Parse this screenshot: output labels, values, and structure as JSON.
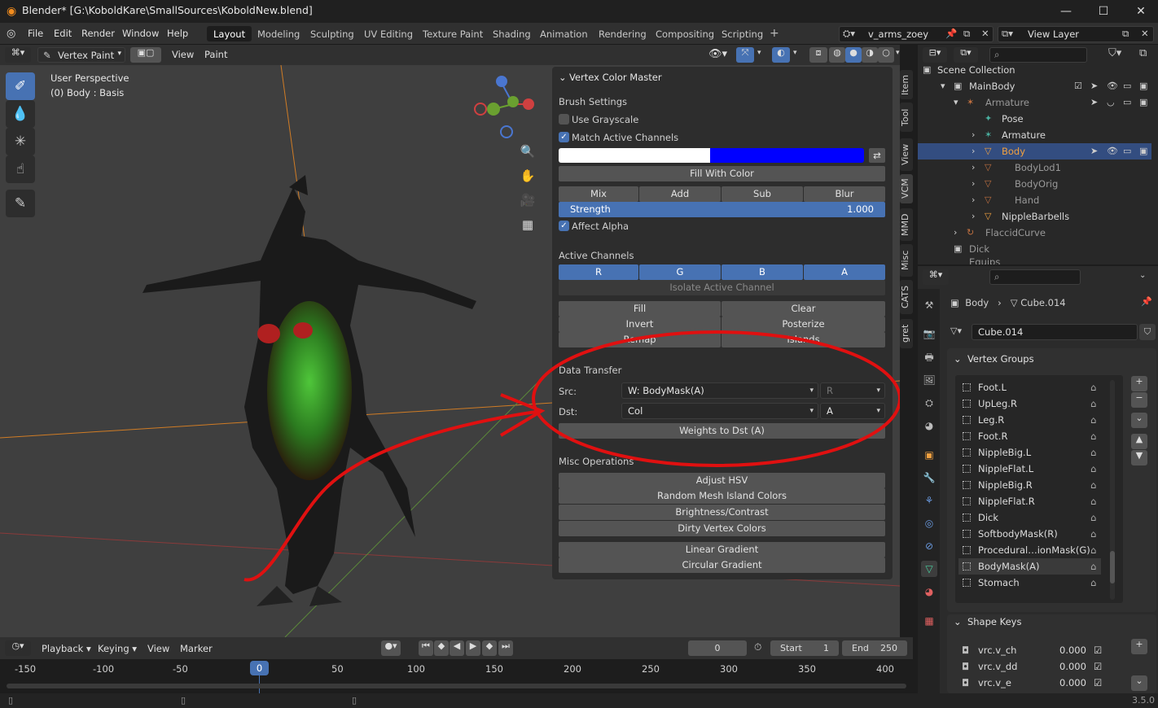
{
  "window": {
    "title": "Blender* [G:\\KoboldKare\\SmallSources\\KoboldNew.blend]"
  },
  "menu": {
    "items": [
      "File",
      "Edit",
      "Render",
      "Window",
      "Help"
    ]
  },
  "workspaces": [
    "Layout",
    "Modeling",
    "Sculpting",
    "UV Editing",
    "Texture Paint",
    "Shading",
    "Animation",
    "Rendering",
    "Compositing",
    "Scripting"
  ],
  "scene": {
    "name": "v_arms_zoey",
    "view_layer": "View Layer"
  },
  "viewport_header": {
    "mode": "Vertex Paint",
    "view": "View",
    "paint": "Paint"
  },
  "viewport": {
    "perspective": "User Perspective",
    "object_info": "(0) Body : Basis"
  },
  "vcm": {
    "title": "Vertex Color Master",
    "brush_settings": "Brush Settings",
    "use_grayscale": "Use Grayscale",
    "match_active_channels": "Match Active Channels",
    "fill_with_color": "Fill With Color",
    "blend_modes": [
      "Mix",
      "Add",
      "Sub",
      "Blur"
    ],
    "strength_label": "Strength",
    "strength_value": "1.000",
    "affect_alpha": "Affect Alpha",
    "active_channels": "Active Channels",
    "channels": [
      "R",
      "G",
      "B",
      "A"
    ],
    "isolate": "Isolate Active Channel",
    "ops": [
      "Fill",
      "Clear",
      "Invert",
      "Posterize",
      "Remap",
      "Islands"
    ],
    "data_transfer": "Data Transfer",
    "src_label": "Src:",
    "src_value": "W: BodyMask(A)",
    "src_channel": "R",
    "dst_label": "Dst:",
    "dst_value": "Col",
    "dst_channel": "A",
    "weights_button": "Weights to Dst (A)",
    "misc_title": "Misc Operations",
    "misc": [
      "Adjust HSV",
      "Random Mesh Island Colors",
      "Brightness/Contrast",
      "Dirty Vertex Colors"
    ],
    "gradients": [
      "Linear Gradient",
      "Circular Gradient"
    ],
    "color1": "#ffffff",
    "color2": "#0000ff"
  },
  "side_tabs": [
    "Item",
    "Tool",
    "View",
    "VCM",
    "MMD",
    "Misc",
    "CATS",
    "gret"
  ],
  "outliner": {
    "root": "Scene Collection",
    "rows": [
      "MainBody",
      "Armature",
      "Pose",
      "Armature",
      "Body",
      "BodyLod1",
      "BodyOrig",
      "Hand",
      "NippleBarbells",
      "FlaccidCurve",
      "Dick",
      "Equips"
    ]
  },
  "properties": {
    "breadcrumb_object": "Body",
    "breadcrumb_data": "Cube.014",
    "mesh_name": "Cube.014",
    "vertex_groups_title": "Vertex Groups",
    "vertex_groups": [
      "Foot.L",
      "UpLeg.R",
      "Leg.R",
      "Foot.R",
      "NippleBig.L",
      "NippleFlat.L",
      "NippleBig.R",
      "NippleFlat.R",
      "Dick",
      "SoftbodyMask(R)",
      "Procedural…ionMask(G)",
      "BodyMask(A)",
      "Stomach"
    ],
    "shape_keys_title": "Shape Keys",
    "shape_keys": [
      {
        "name": "vrc.v_ch",
        "value": "0.000"
      },
      {
        "name": "vrc.v_dd",
        "value": "0.000"
      },
      {
        "name": "vrc.v_e",
        "value": "0.000"
      }
    ]
  },
  "timeline": {
    "menus": [
      "Playback",
      "Keying",
      "View",
      "Marker"
    ],
    "current_frame": "0",
    "start_label": "Start",
    "start": "1",
    "end_label": "End",
    "end": "250",
    "ticks": [
      "-150",
      "-100",
      "-50",
      "0",
      "50",
      "100",
      "150",
      "200",
      "250",
      "300",
      "350",
      "400"
    ]
  },
  "status": {
    "version": "3.5.0"
  }
}
